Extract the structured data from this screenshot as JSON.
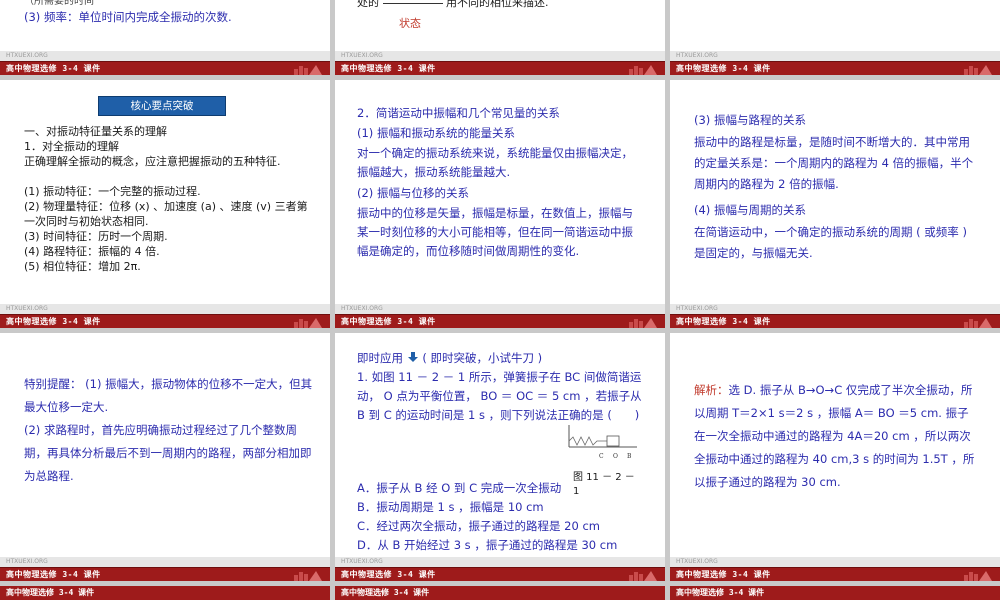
{
  "footer": {
    "caption": "高中物理选修 3-4 课件",
    "strip_text": "HTXUEXI.ORG"
  },
  "slide1": {
    "line1": "（所需要的时间",
    "line2": "(3) 频率：单位时间内完成全振动的次数."
  },
  "slide2": {
    "line1_prefix": "处的",
    "line1_suffix": "用不同的相位来描述.",
    "answer": "状态"
  },
  "slide4": {
    "badge": "核心要点突破",
    "heading": "一、对振动特征量关系的理解",
    "sub": "1．对全振动的理解",
    "intro": "正确理解全振动的概念，应注意把握振动的五种特征.",
    "items": [
      "(1) 振动特征：一个完整的振动过程.",
      "(2) 物理量特征：位移 (x) 、加速度 (a) 、速度 (v) 三者第一次同时与初始状态相同.",
      "(3) 时间特征：历时一个周期.",
      "(4) 路程特征：振幅的 4 倍.",
      "(5) 相位特征：增加 2π."
    ]
  },
  "slide5": {
    "heading": "2．简谐运动中振幅和几个常见量的关系",
    "p1_title": "(1) 振幅和振动系统的能量关系",
    "p1": "对一个确定的振动系统来说，系统能量仅由振幅决定，振幅越大，振动系统能量越大.",
    "p2_title": "(2) 振幅与位移的关系",
    "p2": "振动中的位移是矢量，振幅是标量，在数值上，振幅与某一时刻位移的大小可能相等，但在同一简谐运动中振幅是确定的，而位移随时间做周期性的变化."
  },
  "slide6": {
    "p3_title": "(3) 振幅与路程的关系",
    "p3": "振动中的路程是标量，是随时间不断增大的．其中常用的定量关系是：一个周期内的路程为 4 倍的振幅，半个周期内的路程为 2 倍的振幅.",
    "p4_title": "(4) 振幅与周期的关系",
    "p4": "在简谐运动中，一个确定的振动系统的周期 ( 或频率 ) 是固定的，与振幅无关."
  },
  "slide7": {
    "text": "特别提醒： (1) 振幅大，振动物体的位移不一定大，但其最大位移一定大.",
    "text2": "(2) 求路程时，首先应明确振动过程经过了几个整数周期，再具体分析最后不到一周期内的路程，两部分相加即为总路程."
  },
  "slide8": {
    "header": "即时应用",
    "header_note": "( 即时突破，小试牛刀 )",
    "question": "1. 如图 11 － 2 － 1 所示，弹簧振子在 BC 间做简谐运动， O 点为平衡位置， BO ＝ OC ＝ 5 cm ，若振子从 B 到 C 的运动时间是 1 s ，则下列说法正确的是 (　　)",
    "figure_labels": [
      "C",
      "O",
      "B"
    ],
    "figure_caption": "图 11 － 2 － 1",
    "options": [
      "A．振子从 B 经 O 到 C 完成一次全振动",
      "B．振动周期是 1 s ，振幅是 10 cm",
      "C．经过两次全振动，振子通过的路程是 20 cm",
      "D．从 B 开始经过 3 s ，振子通过的路程是 30 cm"
    ]
  },
  "slide9": {
    "label": "解析：",
    "text": "选 D. 振子从 B→O→C 仅完成了半次全振动，所以周期 T＝2×1 s＝2 s ，振幅 A＝ BO ＝5 cm. 振子在一次全振动中通过的路程为 4A＝20 cm ，所以两次全振动中通过的路程为 40 cm,3 s 的时间为 1.5T ，所以振子通过的路程为 30 cm."
  }
}
